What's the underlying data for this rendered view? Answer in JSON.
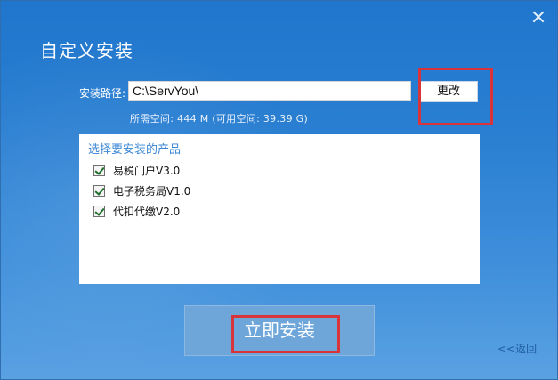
{
  "window": {
    "title": "自定义安装",
    "close_icon": "close-icon"
  },
  "install_path": {
    "label": "安装路径:",
    "value": "C:\\ServYou\\",
    "change_label": "更改",
    "space_info": "所需空间: 444 M (可用空间: 39.39 G)"
  },
  "products": {
    "title": "选择要安装的产品",
    "items": [
      {
        "label": "易税门户V3.0",
        "checked": true
      },
      {
        "label": "电子税务局V1.0",
        "checked": true
      },
      {
        "label": "代扣代缴V2.0",
        "checked": true
      }
    ]
  },
  "actions": {
    "install_label": "立即安装",
    "back_label": "<<返回"
  },
  "colors": {
    "accent": "#2a7fd2",
    "highlight": "#d9343a",
    "install_button": "#6ea6da",
    "panel_title": "#3a86d6"
  }
}
